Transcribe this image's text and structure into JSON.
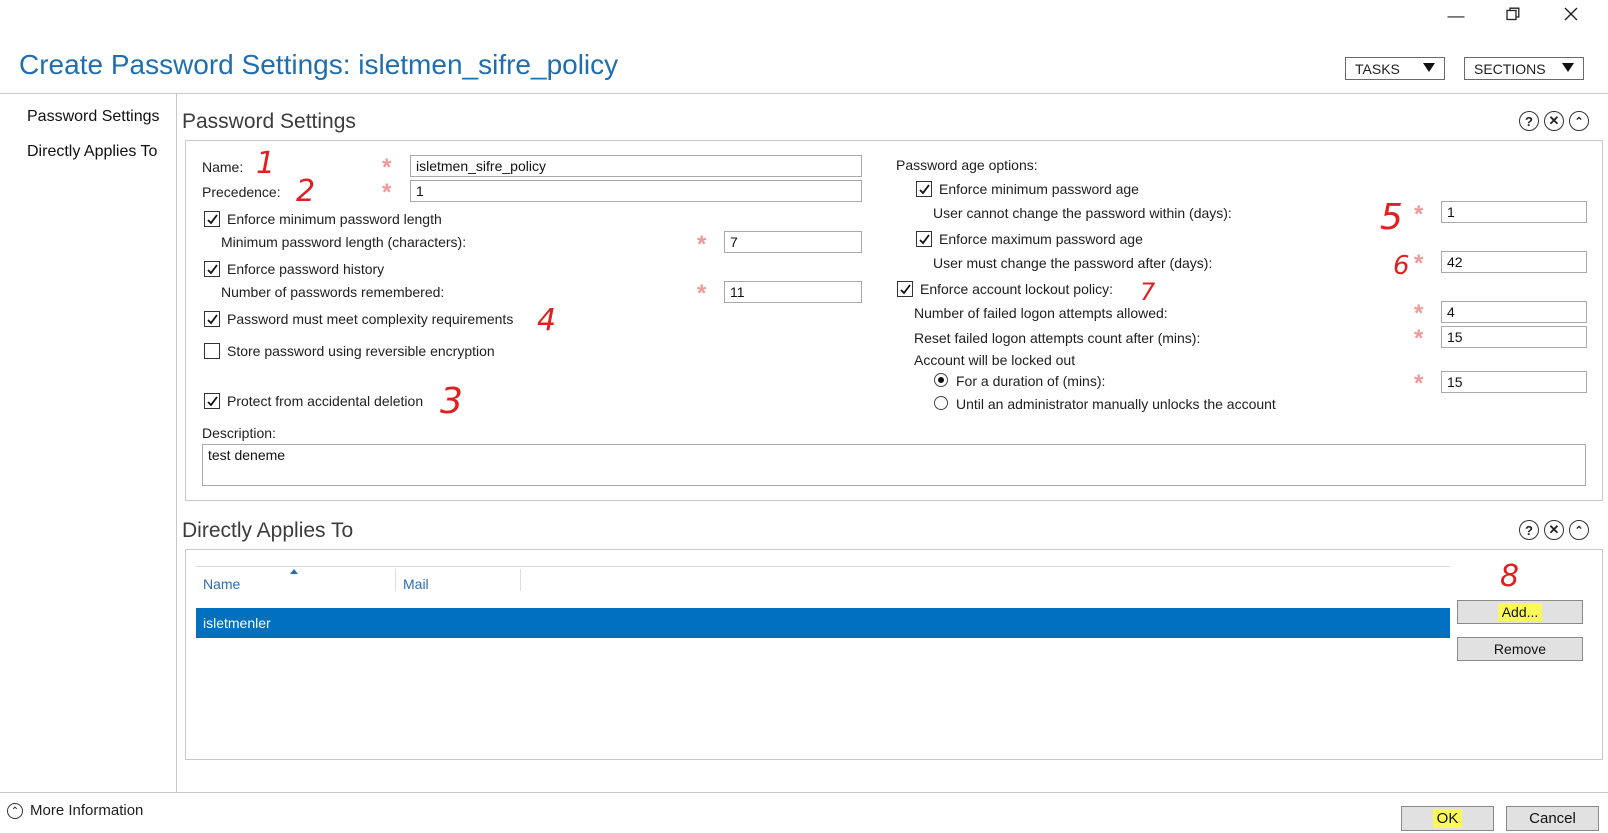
{
  "window": {
    "minimize_icon": "minimize-icon",
    "restore_icon": "restore-icon",
    "close_icon": "close-icon"
  },
  "header": {
    "title": "Create Password Settings: isletmen_sifre_policy",
    "tasks_label": "TASKS",
    "sections_label": "SECTIONS"
  },
  "nav": {
    "items": [
      {
        "label": "Password Settings"
      },
      {
        "label": "Directly Applies To"
      }
    ]
  },
  "password_settings": {
    "section_title": "Password Settings",
    "name_label": "Name:",
    "name_value": "isletmen_sifre_policy",
    "precedence_label": "Precedence:",
    "precedence_value": "1",
    "enforce_min_length_label": "Enforce minimum password length",
    "enforce_min_length_checked": true,
    "min_length_label": "Minimum password length (characters):",
    "min_length_value": "7",
    "enforce_history_label": "Enforce password history",
    "enforce_history_checked": true,
    "history_count_label": "Number of passwords remembered:",
    "history_count_value": "11",
    "complexity_label": "Password must meet complexity requirements",
    "complexity_checked": true,
    "reversible_label": "Store password using reversible encryption",
    "reversible_checked": false,
    "protect_label": "Protect from accidental deletion",
    "protect_checked": true,
    "description_label": "Description:",
    "description_value": "test deneme",
    "age_options_label": "Password age options:",
    "enforce_min_age_label": "Enforce minimum password age",
    "enforce_min_age_checked": true,
    "min_age_label": "User cannot change the password within (days):",
    "min_age_value": "1",
    "enforce_max_age_label": "Enforce maximum password age",
    "enforce_max_age_checked": true,
    "max_age_label": "User must change the password after (days):",
    "max_age_value": "42",
    "lockout_label": "Enforce account lockout policy:",
    "lockout_checked": true,
    "failed_attempts_label": "Number of failed logon attempts allowed:",
    "failed_attempts_value": "4",
    "reset_count_label": "Reset failed logon attempts count after (mins):",
    "reset_count_value": "15",
    "locked_out_label": "Account will be locked out",
    "duration_label": "For a duration of (mins):",
    "duration_value": "15",
    "duration_selected": true,
    "admin_unlock_label": "Until an administrator manually unlocks the account",
    "admin_unlock_selected": false
  },
  "directly_applies_to": {
    "section_title": "Directly Applies To",
    "columns": [
      "Name",
      "Mail"
    ],
    "rows": [
      {
        "name": "isletmenler",
        "mail": ""
      }
    ],
    "add_label": "Add...",
    "remove_label": "Remove"
  },
  "annotations": [
    "1",
    "2",
    "3",
    "4",
    "5",
    "6",
    "7",
    "8"
  ],
  "footer": {
    "more_info_label": "More Information",
    "ok_label": "OK",
    "cancel_label": "Cancel"
  },
  "colors": {
    "title_blue": "#1f6fb0",
    "selection_blue": "#0070c0",
    "required_pink": "#ee9a9a",
    "annotation_red": "#e02020",
    "highlight_yellow": "#fbf95a"
  }
}
